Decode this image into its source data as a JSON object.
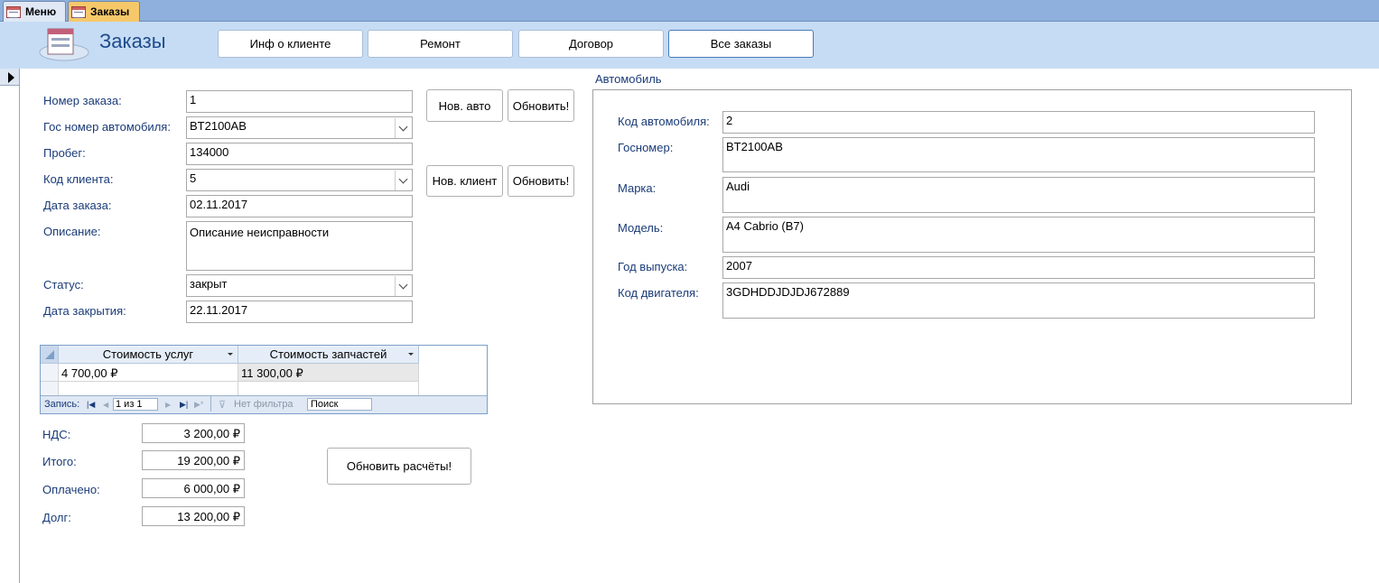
{
  "tabs": [
    {
      "label": "Меню",
      "active": false
    },
    {
      "label": "Заказы",
      "active": true
    }
  ],
  "header": {
    "title": "Заказы",
    "buttons": [
      "Инф о клиенте",
      "Ремонт",
      "Договор",
      "Все заказы"
    ]
  },
  "order": {
    "labels": {
      "order_no": "Номер заказа:",
      "plate": "Гос номер автомобиля:",
      "mileage": "Пробег:",
      "client": "Код клиента:",
      "date": "Дата заказа:",
      "desc": "Описание:",
      "status": "Статус:",
      "closed": "Дата закрытия:"
    },
    "values": {
      "order_no": "1",
      "plate": "BT2100AB",
      "mileage": "134000",
      "client": "5",
      "date": "02.11.2017",
      "desc": "Описание неисправности",
      "status": "закрыт",
      "closed": "22.11.2017"
    }
  },
  "actions": {
    "new_car": "Нов. авто",
    "refresh1": "Обновить!",
    "new_client": "Нов. клиент",
    "refresh2": "Обновить!",
    "recalc": "Обновить расчёты!"
  },
  "costs": {
    "columns": [
      "Стоимость услуг",
      "Стоимость запчастей"
    ],
    "rows": [
      [
        "4 700,00 ₽",
        "11 300,00 ₽"
      ]
    ],
    "nav": {
      "record_label": "Запись:",
      "position": "1 из 1",
      "filter": "Нет фильтра",
      "search": "Поиск"
    }
  },
  "totals": {
    "labels": {
      "vat": "НДС:",
      "total": "Итого:",
      "paid": "Оплачено:",
      "debt": "Долг:"
    },
    "values": {
      "vat": "3 200,00 ₽",
      "total": "19 200,00 ₽",
      "paid": "6 000,00 ₽",
      "debt": "13 200,00 ₽"
    }
  },
  "car": {
    "title": "Автомобиль",
    "labels": {
      "car_id": "Код автомобиля:",
      "plate": "Госномер:",
      "make": "Марка:",
      "model": "Модель:",
      "year": "Год выпуска:",
      "engine": "Код двигателя:"
    },
    "values": {
      "car_id": "2",
      "plate": "BT2100AB",
      "make": "Audi",
      "model": "A4 Cabrio (B7)",
      "year": "2007",
      "engine": "3GDHDDJDJDJ672889"
    }
  },
  "colors": {
    "label": "#1a3b78",
    "header_bg": "#c6dcf4",
    "tab_active": "#f6c86a"
  }
}
